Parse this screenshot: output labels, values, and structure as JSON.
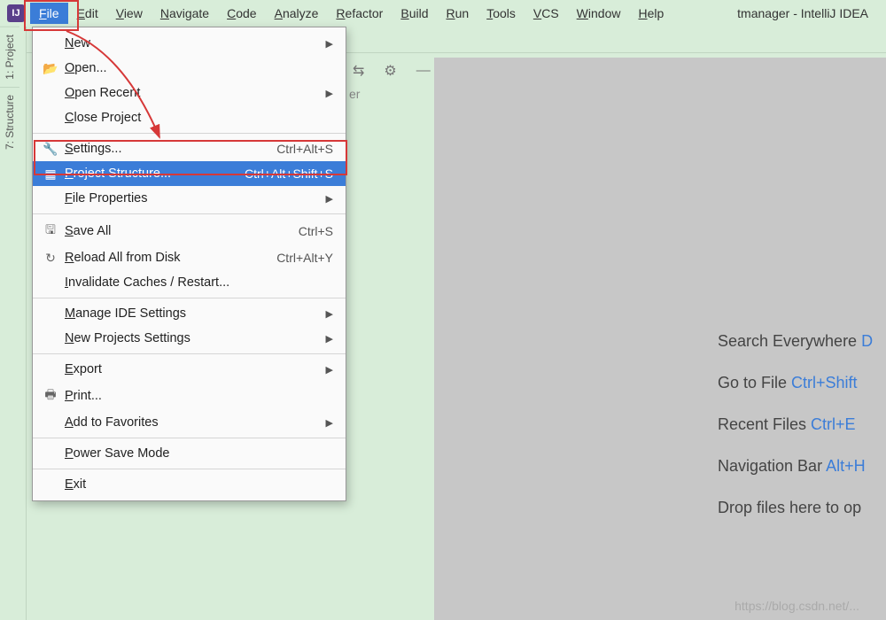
{
  "menubar": {
    "items": [
      "File",
      "Edit",
      "View",
      "Navigate",
      "Code",
      "Analyze",
      "Refactor",
      "Build",
      "Run",
      "Tools",
      "VCS",
      "Window",
      "Help"
    ],
    "active_index": 0,
    "window_title": "tmanager - IntelliJ IDEA"
  },
  "left_tabs": {
    "project": "1: Project",
    "structure": "7: Structure"
  },
  "dropdown": {
    "groups": [
      [
        {
          "icon": "",
          "label": "New",
          "submenu": true
        },
        {
          "icon": "📂",
          "label": "Open..."
        },
        {
          "icon": "",
          "label": "Open Recent",
          "submenu": true
        },
        {
          "icon": "",
          "label": "Close Project"
        }
      ],
      [
        {
          "icon": "🔧",
          "label": "Settings...",
          "shortcut": "Ctrl+Alt+S"
        },
        {
          "icon": "▦",
          "label": "Project Structure...",
          "shortcut": "Ctrl+Alt+Shift+S",
          "highlighted": true
        },
        {
          "icon": "",
          "label": "File Properties",
          "submenu": true
        }
      ],
      [
        {
          "icon": "🖫",
          "label": "Save All",
          "shortcut": "Ctrl+S"
        },
        {
          "icon": "↻",
          "label": "Reload All from Disk",
          "shortcut": "Ctrl+Alt+Y"
        },
        {
          "icon": "",
          "label": "Invalidate Caches / Restart..."
        }
      ],
      [
        {
          "icon": "",
          "label": "Manage IDE Settings",
          "submenu": true
        },
        {
          "icon": "",
          "label": "New Projects Settings",
          "submenu": true
        }
      ],
      [
        {
          "icon": "",
          "label": "Export",
          "submenu": true
        },
        {
          "icon": "🖶",
          "label": "Print..."
        },
        {
          "icon": "",
          "label": "Add to Favorites",
          "submenu": true
        }
      ],
      [
        {
          "icon": "",
          "label": "Power Save Mode"
        }
      ],
      [
        {
          "icon": "",
          "label": "Exit"
        }
      ]
    ]
  },
  "mini_toolbar": {
    "pin": "⇆",
    "gear": "⚙",
    "minus": "—",
    "below": "er"
  },
  "hints": [
    {
      "text": "Search Everywhere ",
      "key": "D"
    },
    {
      "text": "Go to File ",
      "key": "Ctrl+Shift"
    },
    {
      "text": "Recent Files ",
      "key": "Ctrl+E"
    },
    {
      "text": "Navigation Bar ",
      "key": "Alt+H"
    },
    {
      "text": "Drop files here to op",
      "key": ""
    }
  ],
  "watermark": "https://blog.csdn.net/..."
}
